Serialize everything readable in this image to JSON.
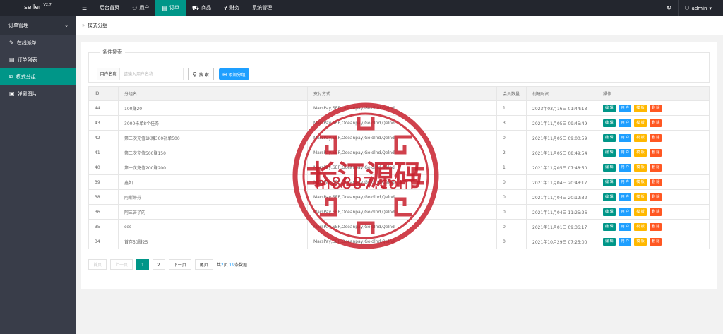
{
  "app": {
    "logo": "seller",
    "version": "V2.7"
  },
  "topnav": {
    "menu_icon": "menu-icon",
    "items": [
      {
        "label": "后台首页",
        "icon": ""
      },
      {
        "label": "用户",
        "icon": "user-icon"
      },
      {
        "label": "订单",
        "icon": "order-icon",
        "active": true
      },
      {
        "label": "商品",
        "icon": "cart-icon"
      },
      {
        "label": "财务",
        "icon": "yen-icon"
      },
      {
        "label": "系统管理",
        "icon": ""
      }
    ],
    "user": "admin"
  },
  "sidebar": {
    "group": "订单管理",
    "items": [
      {
        "label": "在线派单",
        "icon": "edit-icon"
      },
      {
        "label": "订单列表",
        "icon": "list-icon"
      },
      {
        "label": "模式分组",
        "icon": "group-icon",
        "active": true
      },
      {
        "label": "弹窗图片",
        "icon": "image-icon"
      }
    ]
  },
  "breadcrumb": {
    "separator": "»",
    "current": "模式分组"
  },
  "search": {
    "legend": "条件搜索",
    "label": "用户名称",
    "placeholder": "请输入用户名称",
    "search_button": "搜 索",
    "add_button": "添加分组"
  },
  "table": {
    "headers": [
      "ID",
      "分组名",
      "支付方式",
      "会员数量",
      "创建时间",
      "操作"
    ],
    "rows": [
      {
        "id": "44",
        "name": "100赚20",
        "pay": "MarsPay,SEP,Oceanpay,Goldlnd,Qelnd",
        "members": "1",
        "created": "2023年03月16日 01:44:13"
      },
      {
        "id": "43",
        "name": "3000卡单8个任务",
        "pay": "MarsPay,SEP,Oceanpay,Goldlnd,Qelnd",
        "members": "3",
        "created": "2021年11月05日 09:45:49"
      },
      {
        "id": "42",
        "name": "第三次充值1K赚300补单500",
        "pay": "MarsPay,SEP,Oceanpay,Goldlnd,Qelnd",
        "members": "0",
        "created": "2021年11月05日 09:00:59"
      },
      {
        "id": "41",
        "name": "第二次充值500赚150",
        "pay": "MarsPay,SEP,Oceanpay,Goldlnd,Qelnd",
        "members": "2",
        "created": "2021年11月05日 08:49:54"
      },
      {
        "id": "40",
        "name": "第一次充值200赚200",
        "pay": "MarsPay,SEP,Oceanpay,Goldlnd,Qelnd",
        "members": "1",
        "created": "2021年11月05日 07:48:50"
      },
      {
        "id": "39",
        "name": "鑫如",
        "pay": "MarsPay,SEP,Oceanpay,Goldlnd,Qelnd",
        "members": "0",
        "created": "2021年11月04日 20:48:17"
      },
      {
        "id": "38",
        "name": "阿斯蒂芬",
        "pay": "MarsPay,SEP,Oceanpay,Goldlnd,Qelnd",
        "members": "0",
        "created": "2021年11月04日 20:12:32"
      },
      {
        "id": "36",
        "name": "阿三苦了的",
        "pay": "MarsPay,SEP,Oceanpay,Goldlnd,Qelnd",
        "members": "0",
        "created": "2021年11月04日 11:25:26"
      },
      {
        "id": "35",
        "name": "ces",
        "pay": "MarsPay,SEP,Oceanpay,Goldlnd,Qelnd",
        "members": "0",
        "created": "2021年11月01日 09:36:17"
      },
      {
        "id": "34",
        "name": "首存50赚25",
        "pay": "MarsPay,SEP,Oceanpay,Goldlnd,Qelnd",
        "members": "0",
        "created": "2021年10月29日 07:25:00"
      }
    ],
    "ops": {
      "edit": "编 辑",
      "user": "用 户",
      "tpl": "模 板",
      "del": "删 除"
    }
  },
  "pager": {
    "first": "首页",
    "prev": "上一页",
    "pages": [
      "1",
      "2"
    ],
    "current": "1",
    "next": "下一页",
    "last": "尾页",
    "info_pre": "共",
    "total_pages": "2",
    "info_mid": "页",
    "total_records": "19",
    "info_post": "条数据"
  },
  "watermark": {
    "text": "长江源码",
    "url": "m8887.com"
  },
  "colors": {
    "accent": "#009688",
    "topbar": "#23262e",
    "sidebar": "#393d49",
    "blue": "#1e9fff",
    "yellow": "#ffb800",
    "orange": "#ff5722",
    "stamp": "#c8202d"
  }
}
